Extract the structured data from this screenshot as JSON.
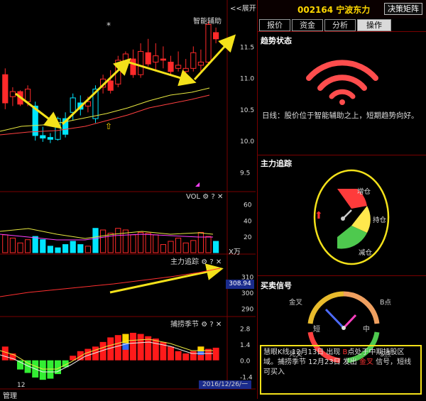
{
  "main_panel": {
    "expand_label": "<<展开",
    "indicator_label": "智能辅助",
    "price_ticks": [
      "11.5",
      "11.0",
      "10.5",
      "10.0",
      "9.5"
    ],
    "candles": [
      {
        "o": 11.05,
        "h": 11.15,
        "l": 10.5,
        "c": 10.6,
        "col": "red"
      },
      {
        "o": 10.7,
        "h": 10.85,
        "l": 10.55,
        "c": 10.78,
        "col": "red"
      },
      {
        "o": 10.78,
        "h": 10.8,
        "l": 10.55,
        "c": 10.58,
        "col": "red"
      },
      {
        "o": 10.62,
        "h": 10.88,
        "l": 10.55,
        "c": 10.82,
        "col": "red"
      },
      {
        "o": 10.55,
        "h": 10.62,
        "l": 10.0,
        "c": 10.08,
        "col": "cyan"
      },
      {
        "o": 10.08,
        "h": 10.22,
        "l": 9.98,
        "c": 10.04,
        "col": "cyan"
      },
      {
        "o": 10.05,
        "h": 10.12,
        "l": 9.96,
        "c": 10.02,
        "col": "cyan"
      },
      {
        "o": 10.02,
        "h": 10.38,
        "l": 10.0,
        "c": 10.35,
        "col": "cyan"
      },
      {
        "o": 10.35,
        "h": 10.45,
        "l": 10.05,
        "c": 10.1,
        "col": "cyan"
      },
      {
        "o": 10.45,
        "h": 10.75,
        "l": 10.32,
        "c": 10.68,
        "col": "cyan"
      },
      {
        "o": 10.6,
        "h": 10.72,
        "l": 10.4,
        "c": 10.5,
        "col": "cyan"
      },
      {
        "o": 10.55,
        "h": 10.7,
        "l": 10.45,
        "c": 10.62,
        "col": "red"
      },
      {
        "o": 10.35,
        "h": 10.88,
        "l": 10.28,
        "c": 10.82,
        "col": "cyan"
      },
      {
        "o": 10.85,
        "h": 11.05,
        "l": 10.75,
        "c": 10.98,
        "col": "red"
      },
      {
        "o": 10.95,
        "h": 11.12,
        "l": 10.75,
        "c": 10.8,
        "col": "red"
      },
      {
        "o": 10.9,
        "h": 11.35,
        "l": 10.85,
        "c": 11.28,
        "col": "red"
      },
      {
        "o": 11.25,
        "h": 11.42,
        "l": 11.15,
        "c": 11.38,
        "col": "red"
      },
      {
        "o": 11.3,
        "h": 11.45,
        "l": 11.0,
        "c": 11.05,
        "col": "red"
      },
      {
        "o": 11.05,
        "h": 11.55,
        "l": 11.0,
        "c": 11.42,
        "col": "red"
      },
      {
        "o": 11.4,
        "h": 11.62,
        "l": 11.18,
        "c": 11.22,
        "col": "red"
      },
      {
        "o": 11.25,
        "h": 11.55,
        "l": 11.1,
        "c": 11.35,
        "col": "red"
      },
      {
        "o": 11.3,
        "h": 11.5,
        "l": 11.15,
        "c": 11.28,
        "col": "red"
      },
      {
        "o": 11.25,
        "h": 11.35,
        "l": 11.05,
        "c": 11.1,
        "col": "red"
      },
      {
        "o": 11.15,
        "h": 11.42,
        "l": 11.1,
        "c": 11.2,
        "col": "red"
      },
      {
        "o": 11.1,
        "h": 11.3,
        "l": 11.05,
        "c": 11.15,
        "col": "red"
      },
      {
        "o": 11.15,
        "h": 11.5,
        "l": 11.1,
        "c": 11.4,
        "col": "red"
      },
      {
        "o": 11.2,
        "h": 11.45,
        "l": 11.1,
        "c": 11.25,
        "col": "red"
      },
      {
        "o": 11.25,
        "h": 11.9,
        "l": 11.2,
        "c": 11.85,
        "col": "red"
      },
      {
        "o": 11.72,
        "h": 11.8,
        "l": 11.55,
        "c": 11.62,
        "col": "red"
      }
    ]
  },
  "vol_panel": {
    "label": "VOL",
    "ticks": [
      "60",
      "40",
      "20"
    ],
    "unit": "X万",
    "bars": [
      22,
      18,
      12,
      16,
      20,
      16,
      8,
      6,
      10,
      14,
      10,
      8,
      30,
      28,
      24,
      30,
      28,
      22,
      25,
      24,
      22,
      10,
      14,
      18,
      12,
      15,
      25,
      20,
      14
    ],
    "bar_colors": [
      "red",
      "red",
      "red",
      "red",
      "cyan",
      "cyan",
      "cyan",
      "cyan",
      "cyan",
      "cyan",
      "cyan",
      "red",
      "cyan",
      "red",
      "red",
      "red",
      "red",
      "red",
      "red",
      "red",
      "red",
      "red",
      "red",
      "red",
      "red",
      "red",
      "red",
      "red",
      "cyan"
    ]
  },
  "main_force_panel": {
    "label": "主力追踪",
    "ticks": [
      "310",
      "300",
      "290"
    ],
    "current_value": "308.94"
  },
  "season_panel": {
    "label": "捕捞季节",
    "ticks": [
      "2.8",
      "1.4",
      "0.0",
      "-1.4"
    ],
    "bars": [
      1.2,
      0.6,
      -0.8,
      -1.1,
      -1.5,
      -1.7,
      -1.6,
      -1.2,
      -0.6,
      0.4,
      0.8,
      1.0,
      1.2,
      1.6,
      2.0,
      2.2,
      2.3,
      2.4,
      2.3,
      2.1,
      1.9,
      1.6,
      1.2,
      0.8,
      0.6,
      0.8,
      1.2,
      1.0,
      1.1
    ]
  },
  "bottom_bar": {
    "tick_label": "12",
    "date": "2016/12/26/一",
    "manage_label": "管理"
  },
  "right_panel": {
    "stock_title": "002164 宁波东力",
    "matrix_button": "决策矩阵",
    "tabs": [
      {
        "label": "报价",
        "active": false
      },
      {
        "label": "资金",
        "active": false
      },
      {
        "label": "分析",
        "active": false
      },
      {
        "label": "操作",
        "active": true
      }
    ],
    "trend_title": "趋势状态",
    "trend_text": "日线：股价位于智能辅助之上，短期趋势向好。",
    "tracking_title": "主力追踪",
    "gauge_labels": {
      "add": "增仓",
      "hold": "持仓",
      "reduce": "减仓"
    },
    "signal_title": "买卖信号",
    "clock_labels": {
      "golden": "金叉",
      "b_point": "B点",
      "short": "短",
      "mid": "中",
      "dead": "死叉",
      "s_point": "S点"
    },
    "note": {
      "p1": "慧眼K线 12月13日 出现 ",
      "p2": "B",
      "p3": "点处于中期持股区域。捕捞季节 12月23日 发出 ",
      "p4": "金叉",
      "p5": " 信号，短线可买入"
    }
  },
  "colors": {
    "up": "#ff2a2a",
    "down": "#00e5ff",
    "accent": "#ffd700"
  }
}
